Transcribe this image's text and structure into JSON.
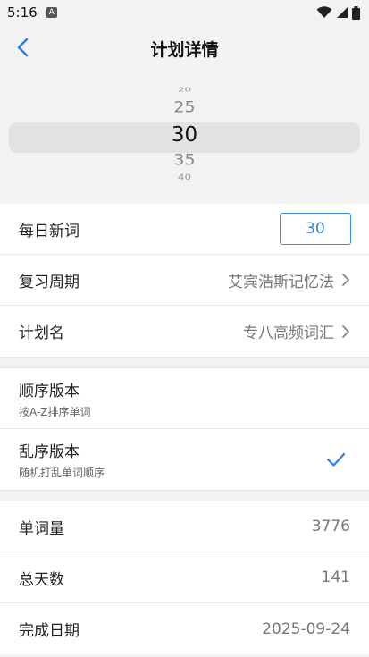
{
  "status_bar": {
    "time": "5:16",
    "app_icon_letter": "A"
  },
  "header": {
    "title": "计划详情"
  },
  "picker": {
    "items": [
      "20",
      "25",
      "30",
      "35",
      "40"
    ]
  },
  "settings": {
    "daily_new_words": {
      "label": "每日新词",
      "value": "30"
    },
    "review_cycle": {
      "label": "复习周期",
      "value": "艾宾浩斯记忆法"
    },
    "plan_name": {
      "label": "计划名",
      "value": "专八高频词汇"
    }
  },
  "order_options": [
    {
      "title": "顺序版本",
      "subtitle": "按A-Z排序单词",
      "selected": false
    },
    {
      "title": "乱序版本",
      "subtitle": "随机打乱单词顺序",
      "selected": true
    }
  ],
  "stats": {
    "word_count": {
      "label": "单词量",
      "value": "3776"
    },
    "total_days": {
      "label": "总天数",
      "value": "141"
    },
    "finish_date": {
      "label": "完成日期",
      "value": "2025-09-24"
    }
  },
  "colors": {
    "accent": "#2d7fd8",
    "background": "#f2f2f2"
  }
}
